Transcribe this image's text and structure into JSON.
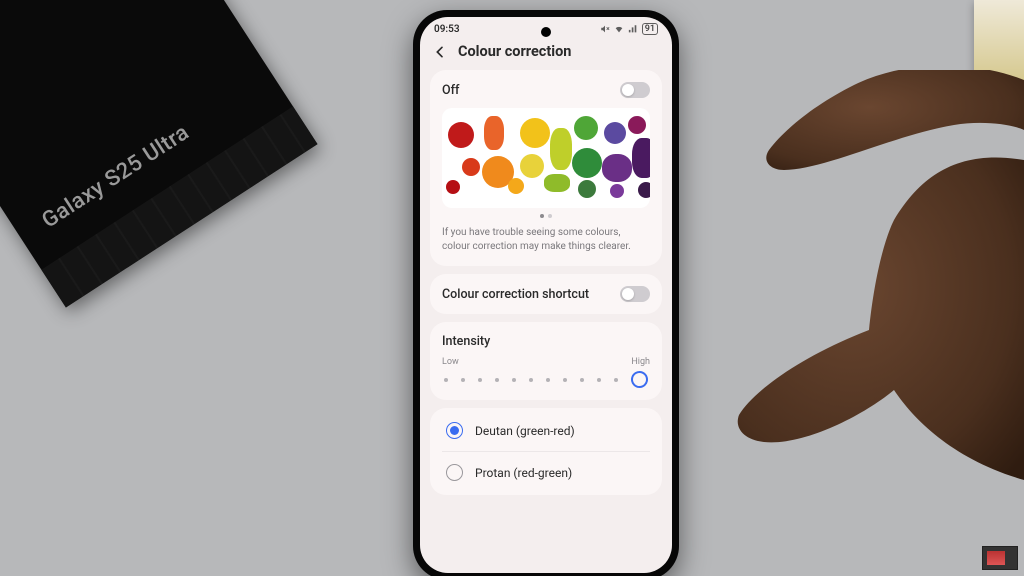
{
  "box_text": "Galaxy S25 Ultra",
  "statusbar": {
    "time": "09:53",
    "battery": "91"
  },
  "header": {
    "title": "Colour correction"
  },
  "main": {
    "toggle_label": "Off",
    "toggle_on": false,
    "description": "If you have trouble seeing some colours, colour correction may make things clearer.",
    "page_indicator": {
      "count": 2,
      "active": 0
    }
  },
  "shortcut": {
    "label": "Colour correction shortcut",
    "on": false
  },
  "intensity": {
    "title": "Intensity",
    "low_label": "Low",
    "high_label": "High",
    "steps": 12,
    "value": 12
  },
  "options": [
    {
      "label": "Deutan (green-red)",
      "selected": true
    },
    {
      "label": "Protan (red-green)",
      "selected": false
    }
  ]
}
